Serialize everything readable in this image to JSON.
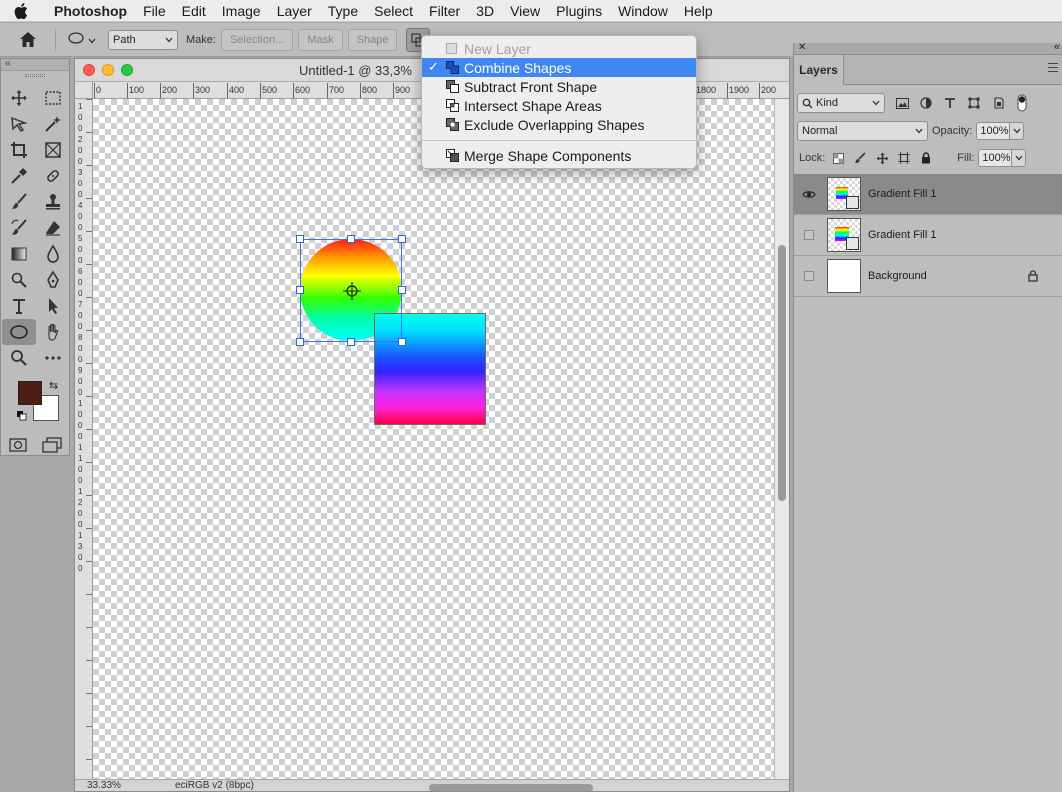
{
  "menubar": {
    "app": "Photoshop",
    "items": [
      "File",
      "Edit",
      "Image",
      "Layer",
      "Type",
      "Select",
      "Filter",
      "3D",
      "View",
      "Plugins",
      "Window",
      "Help"
    ]
  },
  "options": {
    "mode": "Path",
    "make_label": "Make:",
    "selection_btn": "Selection...",
    "mask_btn": "Mask",
    "shape_btn": "Shape"
  },
  "document": {
    "title": "Untitled-1 @ 33,3%",
    "zoom": "33.33%",
    "profile": "eciRGB v2 (8bpc)",
    "hruler": [
      "0",
      "100",
      "200",
      "300",
      "400",
      "500",
      "600",
      "700",
      "800",
      "900",
      "1800",
      "1900",
      "200"
    ],
    "vruler": [
      "1",
      "0",
      "0",
      "2",
      "0",
      "0",
      "3",
      "0",
      "0",
      "4",
      "0",
      "0",
      "5",
      "0",
      "0",
      "6",
      "0",
      "0",
      "7",
      "0",
      "0",
      "8",
      "0",
      "0",
      "9",
      "0",
      "0",
      "1",
      "0",
      "0",
      "0",
      "1",
      "1",
      "0",
      "0",
      "1",
      "2",
      "0",
      "0",
      "1",
      "3",
      "0",
      "0"
    ]
  },
  "dropdown": {
    "items": [
      {
        "label": "New Layer",
        "icon": "new-layer-icon",
        "state": "disabled"
      },
      {
        "label": "Combine Shapes",
        "icon": "combine-shapes-icon",
        "state": "checked"
      },
      {
        "label": "Subtract Front Shape",
        "icon": "subtract-shape-icon",
        "state": "normal"
      },
      {
        "label": "Intersect Shape Areas",
        "icon": "intersect-shape-icon",
        "state": "normal"
      },
      {
        "label": "Exclude Overlapping Shapes",
        "icon": "exclude-shape-icon",
        "state": "normal"
      }
    ],
    "merge": {
      "label": "Merge Shape Components",
      "icon": "merge-shape-icon"
    }
  },
  "layers_panel": {
    "tab": "Layers",
    "filter": "Kind",
    "blend_mode": "Normal",
    "opacity_label": "Opacity:",
    "opacity": "100%",
    "lock_label": "Lock:",
    "fill_label": "Fill:",
    "fill": "100%",
    "layers": [
      {
        "name": "Gradient Fill 1",
        "selected": true,
        "visible": true
      },
      {
        "name": "Gradient Fill 1",
        "selected": false,
        "visible": false
      },
      {
        "name": "Background",
        "selected": false,
        "visible": false,
        "locked": true
      }
    ]
  },
  "colors": {
    "foreground": "#4e1e12",
    "background": "#ffffff",
    "menu_highlight": "#3f86ee",
    "selection": "#3b76e8"
  }
}
